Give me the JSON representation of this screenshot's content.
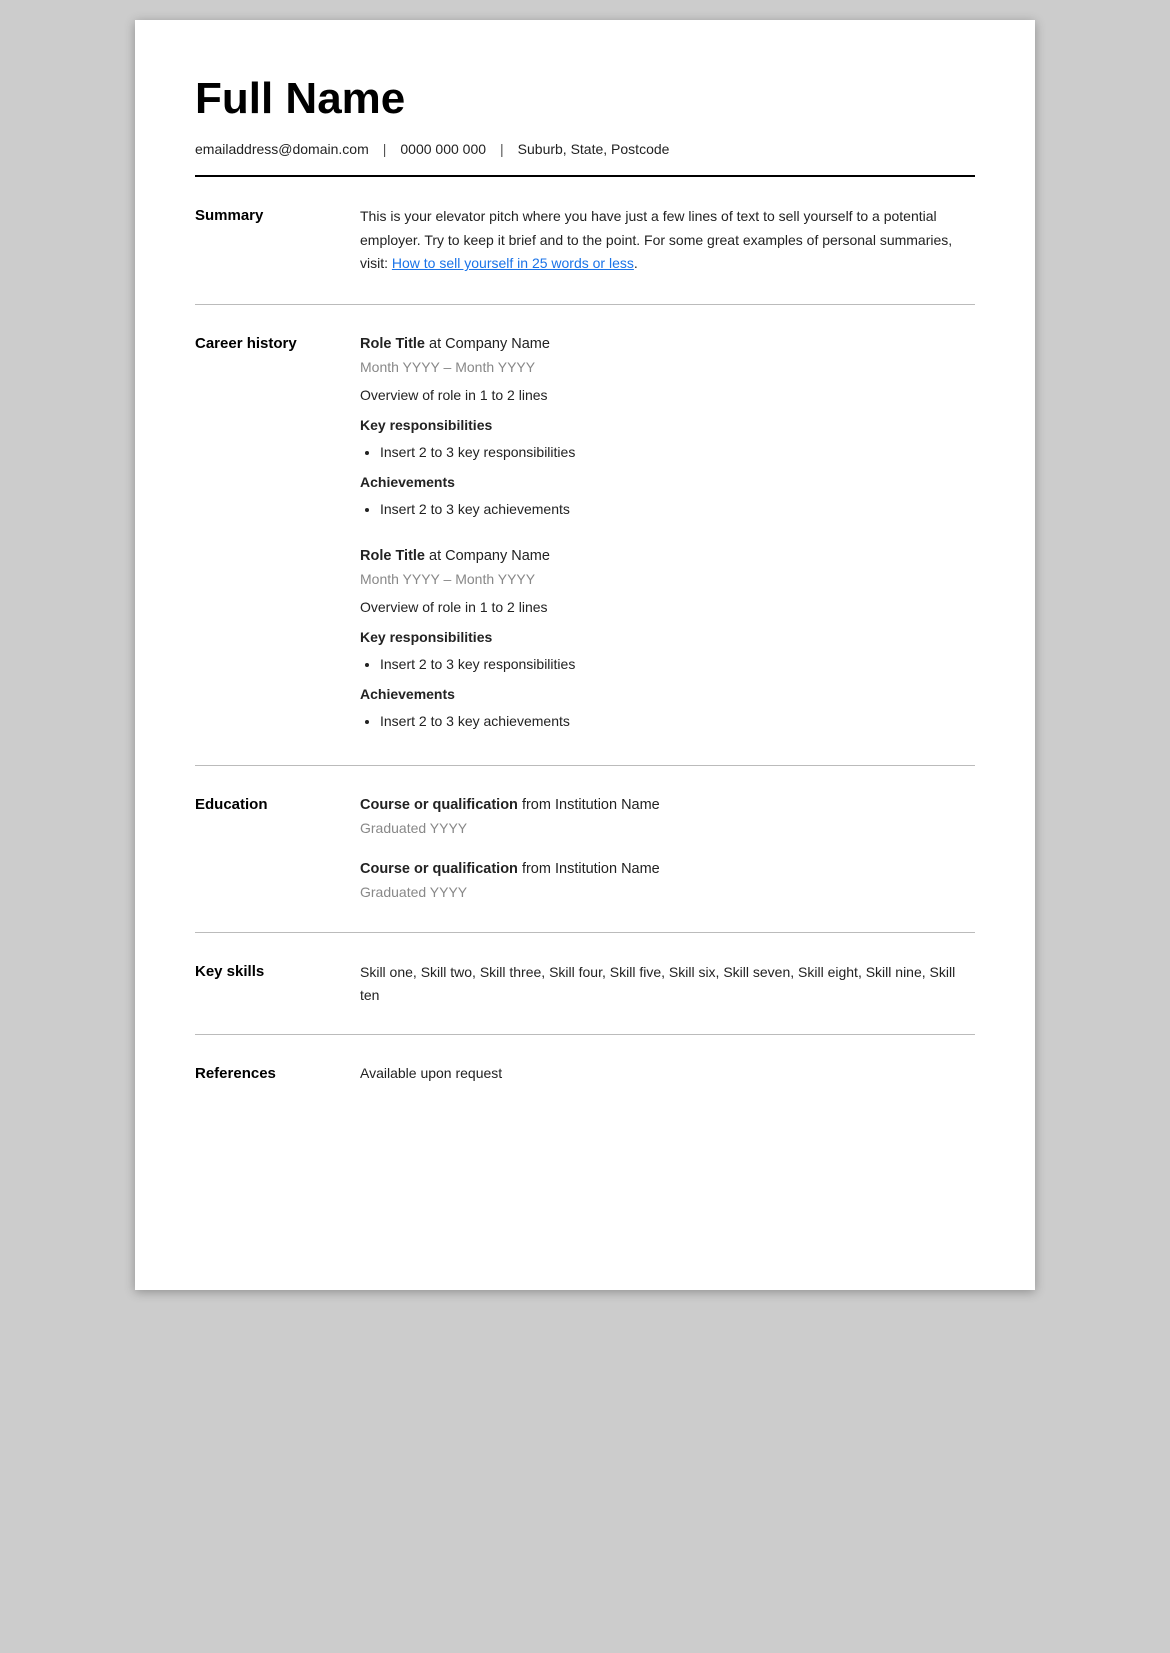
{
  "header": {
    "name": "Full Name",
    "email": "emailaddress@domain.com",
    "phone": "0000 000 000",
    "location": "Suburb, State, Postcode"
  },
  "summary": {
    "label": "Summary",
    "text_before_link": "This is your elevator pitch where you have just a few lines of text to sell yourself to a potential employer. Try to keep it brief and to the point. For some great examples of personal summaries, visit: ",
    "link_text": "How to sell yourself in 25 words or less",
    "link_href": "#",
    "text_after_link": "."
  },
  "career_history": {
    "label": "Career history",
    "jobs": [
      {
        "title_bold": "Role Title",
        "title_rest": " at Company Name",
        "dates": "Month YYYY – Month YYYY",
        "overview": "Overview of role in 1 to 2 lines",
        "responsibilities_label": "Key responsibilities",
        "responsibilities": [
          "Insert 2 to 3 key responsibilities"
        ],
        "achievements_label": "Achievements",
        "achievements": [
          "Insert 2 to 3 key achievements"
        ]
      },
      {
        "title_bold": "Role Title",
        "title_rest": " at Company Name",
        "dates": "Month YYYY – Month YYYY",
        "overview": "Overview of role in 1 to 2 lines",
        "responsibilities_label": "Key responsibilities",
        "responsibilities": [
          "Insert 2 to 3 key responsibilities"
        ],
        "achievements_label": "Achievements",
        "achievements": [
          "Insert 2 to 3 key achievements"
        ]
      }
    ]
  },
  "education": {
    "label": "Education",
    "items": [
      {
        "qualification_bold": "Course or qualification",
        "qualification_rest": " from Institution Name",
        "dates": "Graduated YYYY"
      },
      {
        "qualification_bold": "Course or qualification",
        "qualification_rest": " from Institution Name",
        "dates": "Graduated YYYY"
      }
    ]
  },
  "key_skills": {
    "label": "Key skills",
    "text": "Skill one, Skill two, Skill three, Skill four, Skill five, Skill six, Skill seven, Skill eight, Skill nine, Skill ten"
  },
  "references": {
    "label": "References",
    "text": "Available upon request"
  }
}
